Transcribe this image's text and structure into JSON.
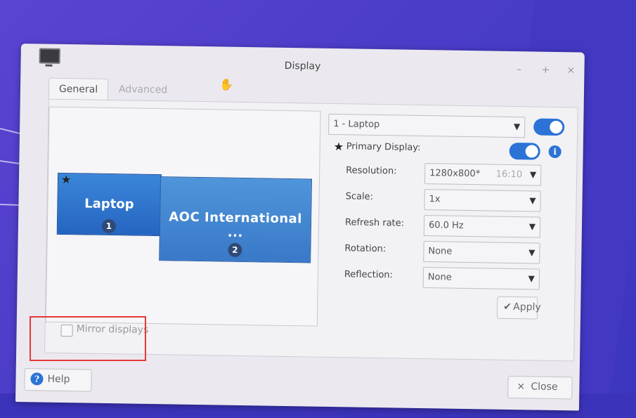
{
  "window": {
    "title": "Display",
    "controls": {
      "minimize": "–",
      "maximize": "+",
      "close": "×"
    }
  },
  "tabs": [
    {
      "label": "General"
    },
    {
      "label": "Advanced"
    }
  ],
  "layout": {
    "monitors": [
      {
        "name": "Laptop",
        "number": "1",
        "primary_star": "★"
      },
      {
        "name": "AOC International ...",
        "number": "2"
      }
    ]
  },
  "settings": {
    "display_select": "1 - Laptop",
    "primary_star": "★",
    "primary_display_label": "Primary Display:",
    "info_glyph": "i",
    "resolution_label": "Resolution:",
    "resolution_value": "1280x800*",
    "resolution_aspect": "16:10",
    "scale_label": "Scale:",
    "scale_value": "1x",
    "refresh_label": "Refresh rate:",
    "refresh_value": "60.0 Hz",
    "rotation_label": "Rotation:",
    "rotation_value": "None",
    "reflection_label": "Reflection:",
    "reflection_value": "None",
    "apply_label": "Apply",
    "apply_icon": "✔"
  },
  "mirror": {
    "label": "Mirror displays",
    "checked": false
  },
  "footer": {
    "help_label": "Help",
    "help_icon": "?",
    "close_label": "Close",
    "close_icon": "×"
  },
  "colors": {
    "accent": "#2b73d6",
    "highlight": "#e53935",
    "desktop": "#4a3cc8"
  }
}
